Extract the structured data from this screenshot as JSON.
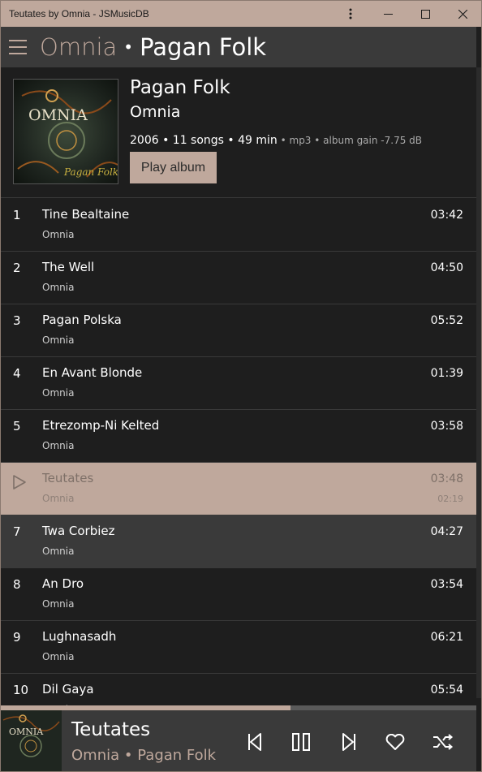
{
  "window": {
    "title": "Teutates by Omnia - JSMusicDB"
  },
  "header": {
    "artist": "Omnia",
    "separator": "•",
    "album": "Pagan Folk"
  },
  "album": {
    "title": "Pagan Folk",
    "artist": "Omnia",
    "summary": "2006 • 11 songs • 49 min",
    "details": " • mp3 • album gain -7.75 dB",
    "play_label": "Play album",
    "cover_text": "Pagan Folk",
    "cover_logo": "OMNIA"
  },
  "tracks": [
    {
      "num": "1",
      "title": "Tine Bealtaine",
      "artist": "Omnia",
      "duration": "03:42"
    },
    {
      "num": "2",
      "title": "The Well",
      "artist": "Omnia",
      "duration": "04:50"
    },
    {
      "num": "3",
      "title": "Pagan Polska",
      "artist": "Omnia",
      "duration": "05:52"
    },
    {
      "num": "4",
      "title": "En Avant Blonde",
      "artist": "Omnia",
      "duration": "01:39"
    },
    {
      "num": "5",
      "title": "Etrezomp-Ni Kelted",
      "artist": "Omnia",
      "duration": "03:58"
    },
    {
      "num": "",
      "title": "Teutates",
      "artist": "Omnia",
      "duration": "03:48",
      "position": "02:19",
      "playing": true
    },
    {
      "num": "7",
      "title": "Twa Corbiez",
      "artist": "Omnia",
      "duration": "04:27",
      "hover": true
    },
    {
      "num": "8",
      "title": "An Dro",
      "artist": "Omnia",
      "duration": "03:54"
    },
    {
      "num": "9",
      "title": "Lughnasadh",
      "artist": "Omnia",
      "duration": "06:21"
    },
    {
      "num": "10",
      "title": "Dil Gaya",
      "artist": "Omnia",
      "duration": "05:54"
    }
  ],
  "progress_fraction": 0.61,
  "now_playing": {
    "title": "Teutates",
    "artist": "Omnia",
    "separator": "•",
    "album": "Pagan Folk"
  },
  "colors": {
    "accent": "#bfa89c",
    "background": "#1e1e1e",
    "header": "#3a3a3a"
  },
  "icons": [
    "menu-icon",
    "more-icon",
    "minimize-icon",
    "maximize-icon",
    "close-icon",
    "play-icon",
    "previous-icon",
    "pause-icon",
    "next-icon",
    "heart-icon",
    "shuffle-icon"
  ]
}
